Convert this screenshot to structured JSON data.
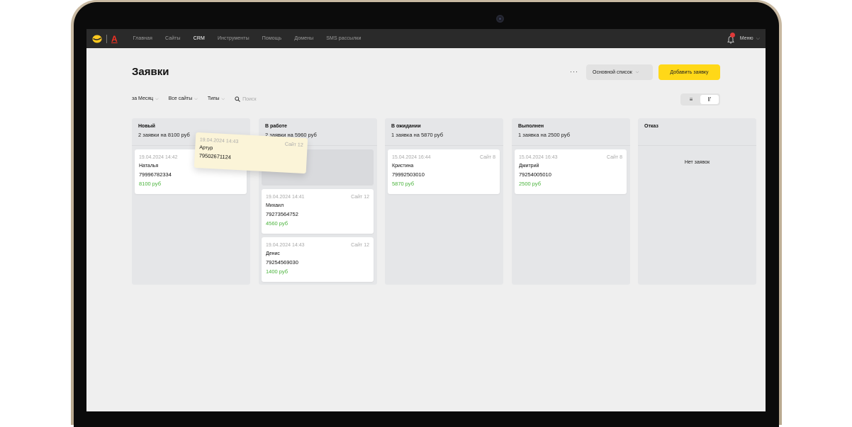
{
  "topbar": {
    "nav": [
      "Главная",
      "Сайты",
      "CRM",
      "Инструменты",
      "Помощь",
      "Домены",
      "SMS рассылки"
    ],
    "active_nav": "CRM",
    "brand_letter": "А",
    "menu_label": "Меню"
  },
  "header": {
    "title": "Заявки",
    "more_label": "···",
    "list_select": "Основной список",
    "add_button": "Добавить заявку"
  },
  "filters": {
    "period": "за Месяц",
    "sites": "Все сайты",
    "types": "Типы",
    "search_placeholder": "Поиск"
  },
  "view_toggle": {
    "list_icon": "≡",
    "board_icon": "ǁ'",
    "selected": "board"
  },
  "columns": [
    {
      "title": "Новый",
      "summary": "2 заявки на 8100 руб",
      "cards": [
        {
          "date": "19.04.2024 14:42",
          "site": "",
          "name": "Наталья",
          "phone": "79996782334",
          "price": "8100 руб"
        }
      ]
    },
    {
      "title": "В работе",
      "summary": "2 заявки на 5960 руб",
      "cards": [
        {
          "date": "19.04.2024 14:41",
          "site": "Сайт 12",
          "name": "Михаил",
          "phone": "79273564752",
          "price": "4560 руб"
        },
        {
          "date": "19.04.2024 14:43",
          "site": "Сайт 12",
          "name": "Денис",
          "phone": "79254569030",
          "price": "1400 руб"
        }
      ]
    },
    {
      "title": "В ожидании",
      "summary": "1 заявка на 5870 руб",
      "cards": [
        {
          "date": "15.04.2024 16:44",
          "site": "Сайт 8",
          "name": "Кристина",
          "phone": "79992503010",
          "price": "5870 руб"
        }
      ]
    },
    {
      "title": "Выполнен",
      "summary": "1 заявка на 2500 руб",
      "cards": [
        {
          "date": "15.04.2024 16:43",
          "site": "Сайт 8",
          "name": "Дмитрий",
          "phone": "79254005010",
          "price": "2500 руб"
        }
      ]
    },
    {
      "title": "Отказ",
      "summary": "",
      "empty_message": "Нет заявок",
      "cards": []
    }
  ],
  "dragging_card": {
    "date": "19.04.2024 14:43",
    "site": "Сайт 12",
    "name": "Артур",
    "phone": "79502671124"
  },
  "colors": {
    "accent": "#ffd818",
    "price": "#49b33b",
    "topbar": "#2a2a2a",
    "brand_red": "#ef3124",
    "notification": "#e03a3a"
  }
}
